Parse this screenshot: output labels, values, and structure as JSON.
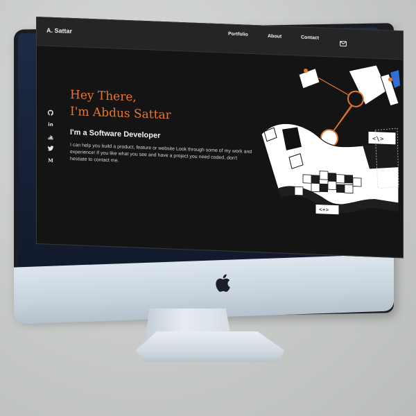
{
  "site": {
    "brand": "A. Sattar",
    "nav": {
      "portfolio": "Portfolio",
      "about": "About",
      "contact": "Contact"
    }
  },
  "hero": {
    "greeting_line1": "Hey There,",
    "greeting_line2": "I'm Abdus Sattar",
    "role": "I'm a Software Developer",
    "description": "I can help you build a product, feature or website Look through some of my work and experience! If you like what you see and have a project you need coded, don't hestiate to contact me."
  },
  "social_icons": [
    "github-icon",
    "linkedin-icon",
    "stackoverflow-icon",
    "twitter-icon",
    "medium-icon"
  ],
  "illustration": {
    "code_tag_1": "<\\>",
    "code_tag_2": "<+>"
  },
  "colors": {
    "accent": "#e8772e",
    "background": "#141414",
    "navbar": "#252525"
  }
}
